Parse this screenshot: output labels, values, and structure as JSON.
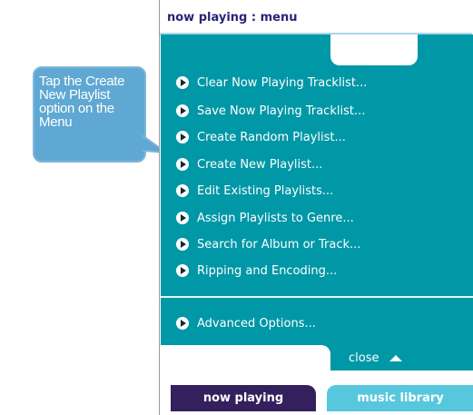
{
  "callout": {
    "text": "Tap the Create New Playlist option on the Menu"
  },
  "header": {
    "title": "now playing : menu"
  },
  "menu": {
    "items": [
      {
        "label": "Clear Now Playing Tracklist..."
      },
      {
        "label": "Save Now Playing Tracklist..."
      },
      {
        "label": "Create Random Playlist..."
      },
      {
        "label": "Create New Playlist..."
      },
      {
        "label": "Edit Existing Playlists..."
      },
      {
        "label": "Assign Playlists to Genre..."
      },
      {
        "label": "Search for Album or Track..."
      },
      {
        "label": "Ripping and Encoding..."
      }
    ],
    "advanced": {
      "label": "Advanced Options..."
    },
    "close_label": "close"
  },
  "tabs": {
    "now_playing": "now playing",
    "music_library": "music library"
  },
  "colors": {
    "menu_bg": "#0097a6",
    "active_tab": "#33205c",
    "inactive_tab": "#57c7dd",
    "callout": "#5fa8d3"
  }
}
